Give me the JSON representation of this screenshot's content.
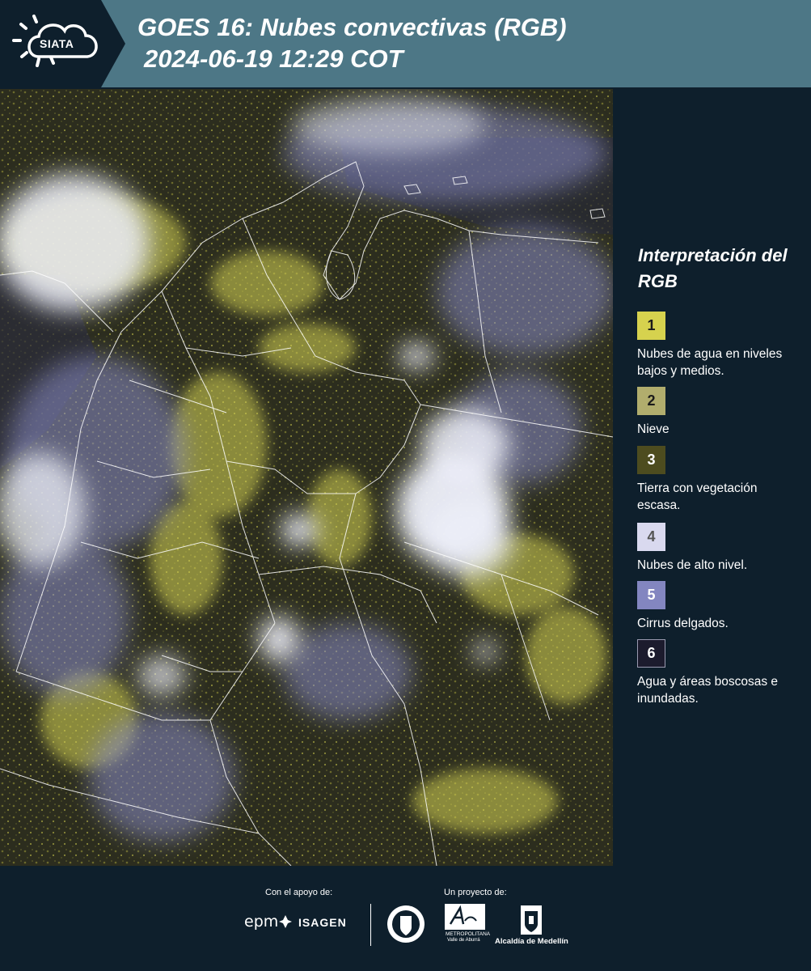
{
  "header": {
    "logo_text": "SIATA",
    "title_line1": "GOES 16: Nubes convectivas (RGB)",
    "title_line2": "2024-06-19 12:29 COT",
    "background_color": "#4d7786"
  },
  "map": {
    "icon": "satellite-image",
    "colors": {
      "vegetation": "#2a2b1c",
      "low_clouds": "#d9d85a",
      "high_clouds": "#e9eaf5",
      "cirrus": "#8a8dc4",
      "borders": "#ffffff"
    }
  },
  "legend": {
    "title": "Interpretación del RGB",
    "items": [
      {
        "number": "1",
        "color": "#d6d24e",
        "label": "Nubes de agua en niveles bajos y medios."
      },
      {
        "number": "2",
        "color": "#b1ad6d",
        "label": "Nieve"
      },
      {
        "number": "3",
        "color": "#4d4c1f",
        "label": "Tierra con vegetación escasa."
      },
      {
        "number": "4",
        "color": "#d9d9ef",
        "label": "Nubes de alto nivel."
      },
      {
        "number": "5",
        "color": "#8386c0",
        "label": "Cirrus delgados."
      },
      {
        "number": "6",
        "color": "#1c1b2d",
        "label": "Agua y áreas boscosas e inundadas."
      }
    ]
  },
  "footer": {
    "support_label": "Con el apoyo de:",
    "project_label": "Un proyecto de:",
    "sponsors": [
      "epm",
      "ISAGEN"
    ],
    "metropolitana_lines": [
      "METROPOLITANA",
      "Valle de Aburrá"
    ],
    "alcaldia": "Alcaldía de Medellín"
  }
}
